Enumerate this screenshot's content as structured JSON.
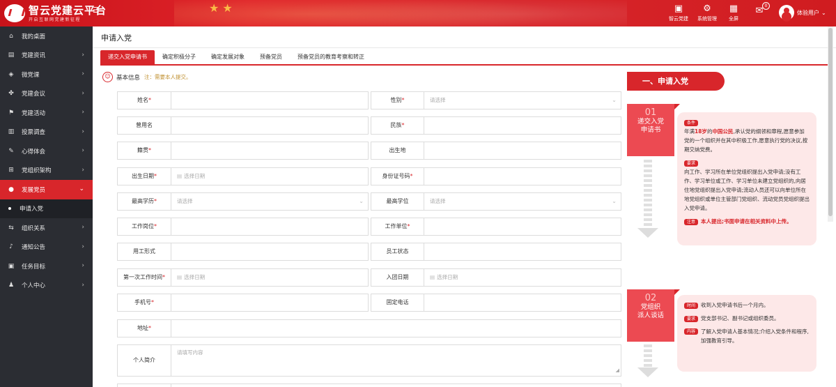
{
  "header": {
    "logo_title": "智云党建云平台",
    "logo_sub": "开启互联网党建新征程",
    "tools": [
      {
        "label": "智云党建",
        "icon": "app-icon"
      },
      {
        "label": "系统管理",
        "icon": "gear-icon"
      },
      {
        "label": "全屏",
        "icon": "fullscreen-icon"
      },
      {
        "label": "",
        "icon": "mail-icon"
      }
    ],
    "badge": "0",
    "user_name": "体验用户"
  },
  "sidebar": {
    "items": [
      {
        "label": "我的桌面",
        "icon": "home-icon"
      },
      {
        "label": "党建资讯",
        "icon": "news-icon"
      },
      {
        "label": "微党课",
        "icon": "course-icon"
      },
      {
        "label": "党建会议",
        "icon": "meeting-icon"
      },
      {
        "label": "党建活动",
        "icon": "flag-icon"
      },
      {
        "label": "投票调查",
        "icon": "chart-icon"
      },
      {
        "label": "心得体会",
        "icon": "note-icon"
      },
      {
        "label": "党组织架构",
        "icon": "org-icon"
      },
      {
        "label": "发展党员",
        "icon": "user-icon"
      },
      {
        "label": "申请入党",
        "icon": "dot-icon"
      },
      {
        "label": "组织关系",
        "icon": "transfer-icon"
      },
      {
        "label": "通知公告",
        "icon": "bell-icon"
      },
      {
        "label": "任务目标",
        "icon": "task-icon"
      },
      {
        "label": "个人中心",
        "icon": "person-icon"
      }
    ]
  },
  "main": {
    "page_title": "申请入党",
    "tabs": [
      "递交入党申请书",
      "确定积极分子",
      "确定发展对象",
      "预备党员",
      "预备党员的教育考察和转正"
    ],
    "section_title": "基本信息",
    "section_note": "注：需要本人提交。",
    "fields": {
      "name": "姓名",
      "gender": "性别",
      "gender_ph": "请选择",
      "former_name": "曾用名",
      "ethnicity": "民族",
      "native_place": "籍贯",
      "birthplace": "出生地",
      "birth_date": "出生日期",
      "birth_date_ph": "选择日期",
      "id_number": "身份证号码",
      "education": "最高学历",
      "education_ph": "请选择",
      "degree": "最高学位",
      "degree_ph": "请选择",
      "job_post": "工作岗位",
      "work_unit": "工作单位",
      "employment_form": "用工形式",
      "employee_status": "员工状态",
      "first_work_date": "第一次工作时间",
      "first_work_date_ph": "选择日期",
      "league_date": "入团日期",
      "league_date_ph": "选择日期",
      "phone": "手机号",
      "landline": "固定电话",
      "address": "地址",
      "intro": "个人简介",
      "intro_ph": "请填写内容"
    }
  },
  "flow": {
    "banner": "一、申请入党",
    "step1": {
      "num": "01",
      "name_line1": "递交入党",
      "name_line2": "申请书",
      "tag1": "条件",
      "cond_pre": "年满",
      "cond_age": "18岁",
      "cond_mid": "的",
      "cond_citizen": "中国公民",
      "cond_rest": ",承认党的纲领和章程,愿意参加党的一个组织并在其中积极工作,愿意执行党的决议,按期交纳党费。",
      "tag2": "要求",
      "req_text": "向工作、学习所在单位党组织提出入党申请;没有工作、学习单位或工作、学习单位未建立党组织的,向居住地党组织提出入党申请;流动人员还可以向单位所在地党组织或单位主管部门党组织、流动党员党组织提出入党申请。",
      "tag3": "注意",
      "note_text": "本人提出;书面申请在相关资料中上传。"
    },
    "step2": {
      "num": "02",
      "name_line1": "党组织",
      "name_line2": "派人谈话",
      "tag1": "时间",
      "time_text": "收到入党申请书后一个月内。",
      "tag2": "要求",
      "req_text": "党支部书记、副书记或组织委员。",
      "tag3": "内容",
      "content_text": "了解入党申请人基本情况;介绍入党条件和程序,加强教育引导。"
    }
  }
}
